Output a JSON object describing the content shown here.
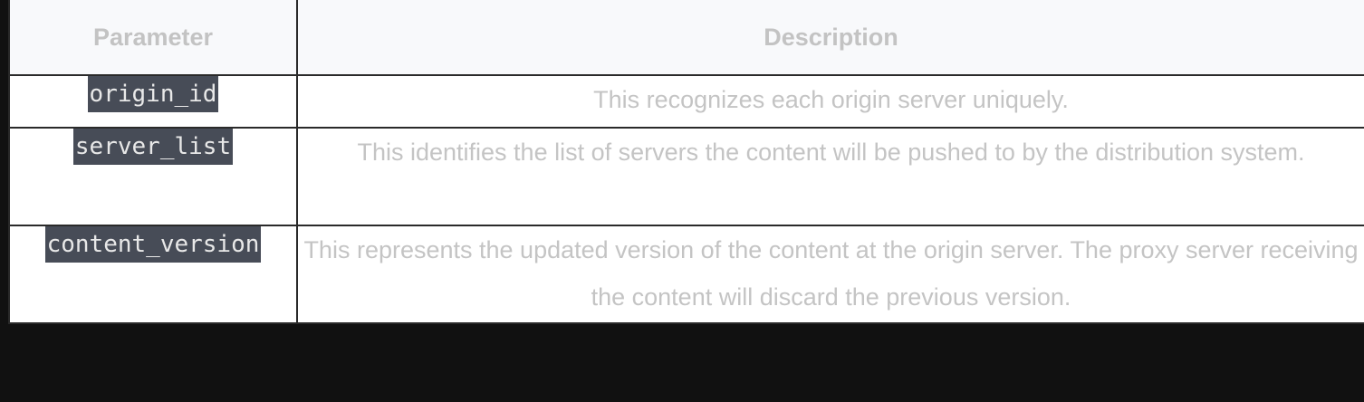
{
  "table": {
    "headers": {
      "parameter": "Parameter",
      "description": "Description"
    },
    "rows": [
      {
        "parameter": "origin_id",
        "description": "This recognizes each origin server uniquely."
      },
      {
        "parameter": "server_list",
        "description": "This identifies the list of servers the content will be pushed to by the distribution system."
      },
      {
        "parameter": "content_version",
        "description": "This represents the updated version of the content at the origin server. The proxy server receiving the content will discard the previous version."
      }
    ]
  }
}
